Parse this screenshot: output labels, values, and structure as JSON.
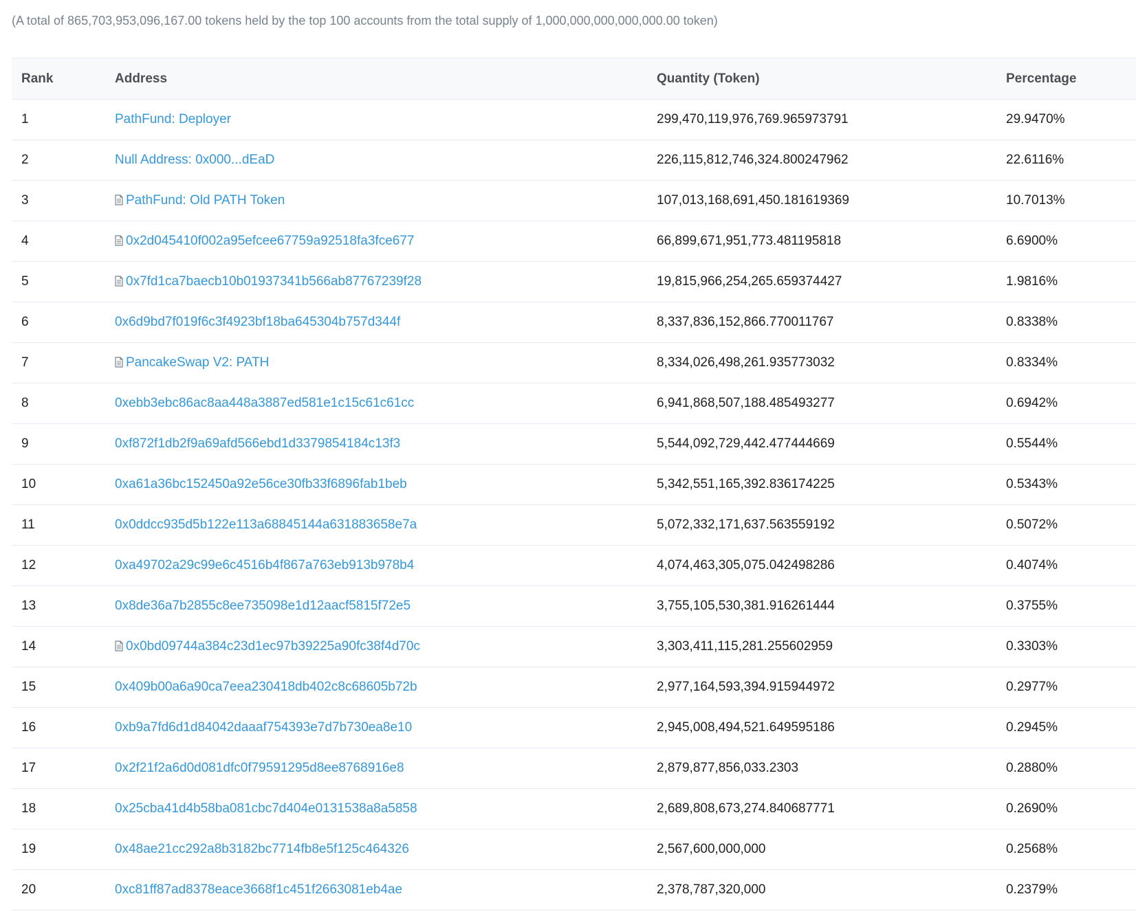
{
  "summary": "(A total of 865,703,953,096,167.00 tokens held by the top 100 accounts from the total supply of 1,000,000,000,000,000.00 token)",
  "table": {
    "headers": {
      "rank": "Rank",
      "address": "Address",
      "quantity": "Quantity (Token)",
      "percentage": "Percentage"
    },
    "rows": [
      {
        "rank": "1",
        "address": "PathFund: Deployer",
        "contract": false,
        "quantity": "299,470,119,976,769.965973791",
        "percentage": "29.9470%"
      },
      {
        "rank": "2",
        "address": "Null Address: 0x000...dEaD",
        "contract": false,
        "quantity": "226,115,812,746,324.800247962",
        "percentage": "22.6116%"
      },
      {
        "rank": "3",
        "address": "PathFund: Old PATH Token",
        "contract": true,
        "quantity": "107,013,168,691,450.181619369",
        "percentage": "10.7013%"
      },
      {
        "rank": "4",
        "address": "0x2d045410f002a95efcee67759a92518fa3fce677",
        "contract": true,
        "quantity": "66,899,671,951,773.481195818",
        "percentage": "6.6900%"
      },
      {
        "rank": "5",
        "address": "0x7fd1ca7baecb10b01937341b566ab87767239f28",
        "contract": true,
        "quantity": "19,815,966,254,265.659374427",
        "percentage": "1.9816%"
      },
      {
        "rank": "6",
        "address": "0x6d9bd7f019f6c3f4923bf18ba645304b757d344f",
        "contract": false,
        "quantity": "8,337,836,152,866.770011767",
        "percentage": "0.8338%"
      },
      {
        "rank": "7",
        "address": "PancakeSwap V2: PATH",
        "contract": true,
        "quantity": "8,334,026,498,261.935773032",
        "percentage": "0.8334%"
      },
      {
        "rank": "8",
        "address": "0xebb3ebc86ac8aa448a3887ed581e1c15c61c61cc",
        "contract": false,
        "quantity": "6,941,868,507,188.485493277",
        "percentage": "0.6942%"
      },
      {
        "rank": "9",
        "address": "0xf872f1db2f9a69afd566ebd1d3379854184c13f3",
        "contract": false,
        "quantity": "5,544,092,729,442.477444669",
        "percentage": "0.5544%"
      },
      {
        "rank": "10",
        "address": "0xa61a36bc152450a92e56ce30fb33f6896fab1beb",
        "contract": false,
        "quantity": "5,342,551,165,392.836174225",
        "percentage": "0.5343%"
      },
      {
        "rank": "11",
        "address": "0x0ddcc935d5b122e113a68845144a631883658e7a",
        "contract": false,
        "quantity": "5,072,332,171,637.563559192",
        "percentage": "0.5072%"
      },
      {
        "rank": "12",
        "address": "0xa49702a29c99e6c4516b4f867a763eb913b978b4",
        "contract": false,
        "quantity": "4,074,463,305,075.042498286",
        "percentage": "0.4074%"
      },
      {
        "rank": "13",
        "address": "0x8de36a7b2855c8ee735098e1d12aacf5815f72e5",
        "contract": false,
        "quantity": "3,755,105,530,381.916261444",
        "percentage": "0.3755%"
      },
      {
        "rank": "14",
        "address": "0x0bd09744a384c23d1ec97b39225a90fc38f4d70c",
        "contract": true,
        "quantity": "3,303,411,115,281.255602959",
        "percentage": "0.3303%"
      },
      {
        "rank": "15",
        "address": "0x409b00a6a90ca7eea230418db402c8c68605b72b",
        "contract": false,
        "quantity": "2,977,164,593,394.915944972",
        "percentage": "0.2977%"
      },
      {
        "rank": "16",
        "address": "0xb9a7fd6d1d84042daaaf754393e7d7b730ea8e10",
        "contract": false,
        "quantity": "2,945,008,494,521.649595186",
        "percentage": "0.2945%"
      },
      {
        "rank": "17",
        "address": "0x2f21f2a6d0d081dfc0f79591295d8ee8768916e8",
        "contract": false,
        "quantity": "2,879,877,856,033.2303",
        "percentage": "0.2880%"
      },
      {
        "rank": "18",
        "address": "0x25cba41d4b58ba081cbc7d404e0131538a8a5858",
        "contract": false,
        "quantity": "2,689,808,673,274.840687771",
        "percentage": "0.2690%"
      },
      {
        "rank": "19",
        "address": "0x48ae21cc292a8b3182bc7714fb8e5f125c464326",
        "contract": false,
        "quantity": "2,567,600,000,000",
        "percentage": "0.2568%"
      },
      {
        "rank": "20",
        "address": "0xc81ff87ad8378eace3668f1c451f2663081eb4ae",
        "contract": false,
        "quantity": "2,378,787,320,000",
        "percentage": "0.2379%"
      }
    ]
  },
  "colors": {
    "link": "#3498db",
    "muted_text": "#77838f",
    "header_bg": "#f8f9fa",
    "border": "#e7eaf3"
  },
  "icons": {
    "contract": "file-contract-icon"
  }
}
